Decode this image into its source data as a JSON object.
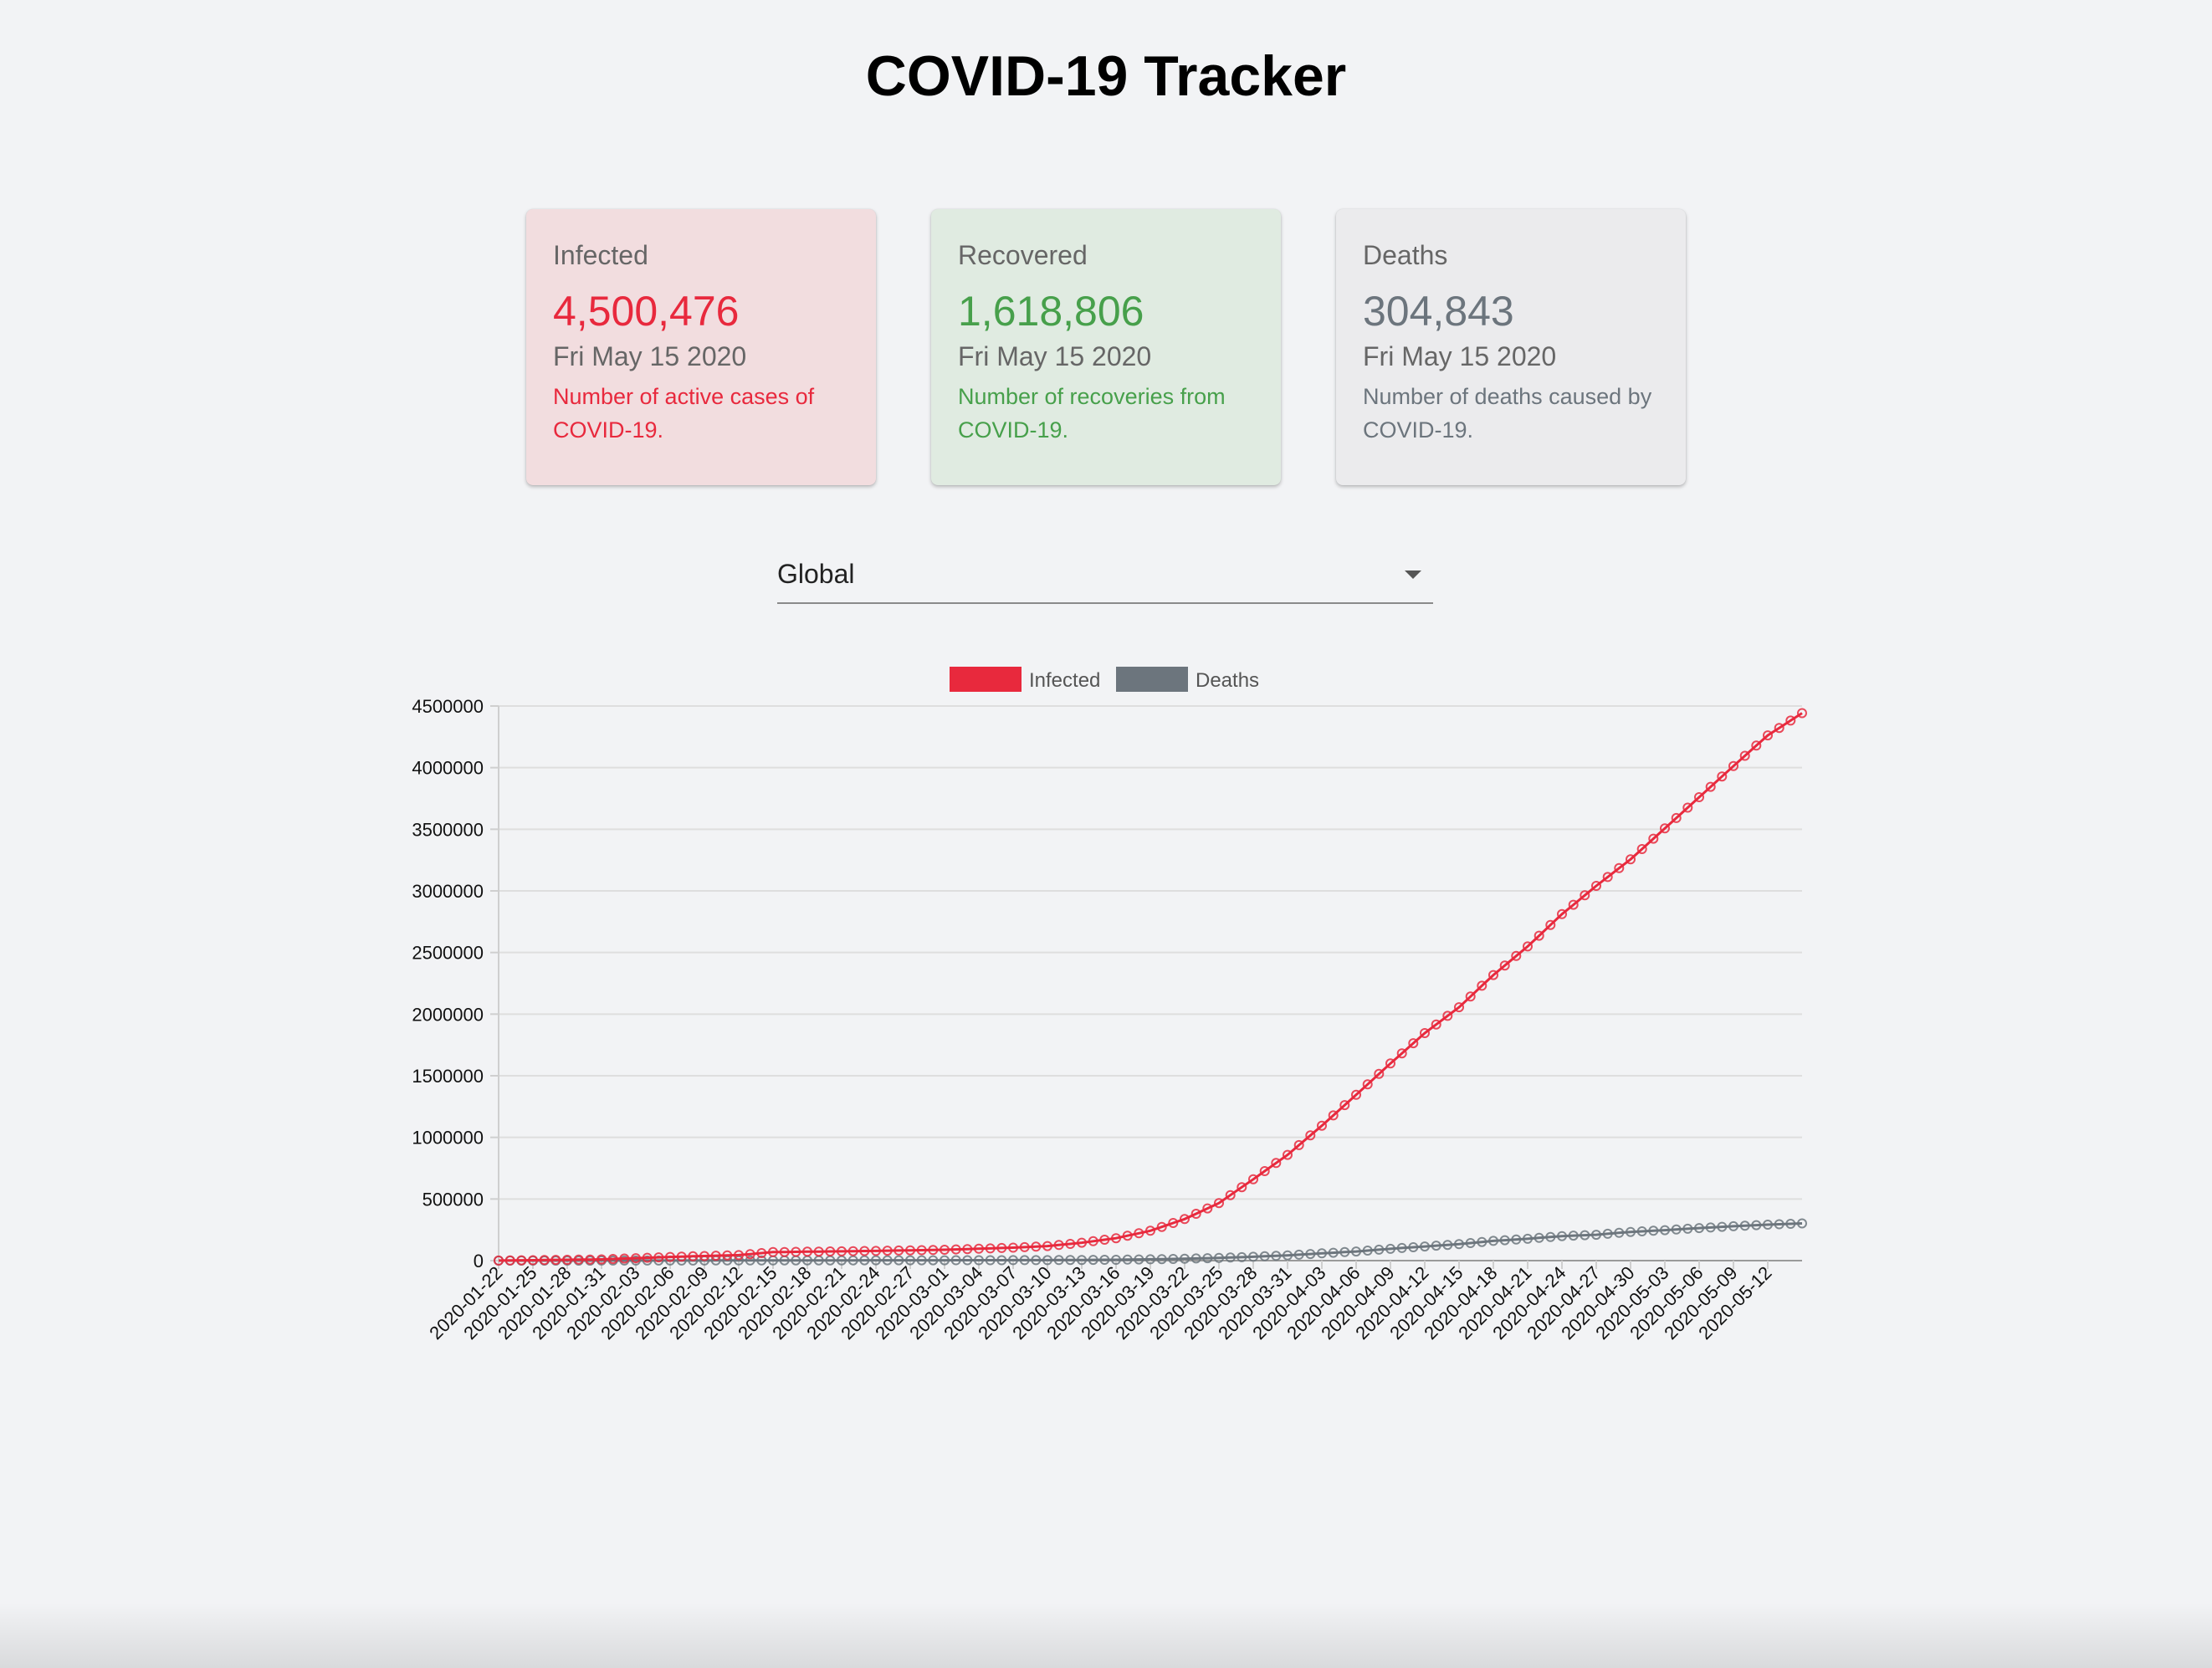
{
  "header": {
    "title": "COVID-19 Tracker"
  },
  "cards": {
    "infected": {
      "label": "Infected",
      "value": "4,500,476",
      "date": "Fri May 15 2020",
      "description": "Number of active cases of COVID-19.",
      "color": "#e8293d"
    },
    "recovered": {
      "label": "Recovered",
      "value": "1,618,806",
      "date": "Fri May 15 2020",
      "description": "Number of recoveries from COVID-19.",
      "color": "#47a04b"
    },
    "deaths": {
      "label": "Deaths",
      "value": "304,843",
      "date": "Fri May 15 2020",
      "description": "Number of deaths caused by COVID-19.",
      "color": "#6c757d"
    }
  },
  "country_select": {
    "selected": "Global",
    "icon": "arrow-drop-down-icon"
  },
  "chart_data": {
    "type": "line",
    "legend_position": "top",
    "grid": true,
    "ylim": [
      0,
      4500000
    ],
    "y_ticks": [
      0,
      500000,
      1000000,
      1500000,
      2000000,
      2500000,
      3000000,
      3500000,
      4000000,
      4500000
    ],
    "x_start": "2020-01-22",
    "x_end": "2020-05-15",
    "x_tick_labels": [
      "2020-01-22",
      "2020-01-25",
      "2020-01-28",
      "2020-01-31",
      "2020-02-03",
      "2020-02-06",
      "2020-02-09",
      "2020-02-12",
      "2020-02-15",
      "2020-02-18",
      "2020-02-21",
      "2020-02-24",
      "2020-02-27",
      "2020-03-01",
      "2020-03-04",
      "2020-03-07",
      "2020-03-10",
      "2020-03-13",
      "2020-03-16",
      "2020-03-19",
      "2020-03-22",
      "2020-03-25",
      "2020-03-28",
      "2020-03-31",
      "2020-04-03",
      "2020-04-06",
      "2020-04-09",
      "2020-04-12",
      "2020-04-15",
      "2020-04-18",
      "2020-04-21",
      "2020-04-24",
      "2020-04-27",
      "2020-04-30",
      "2020-05-03",
      "2020-05-06",
      "2020-05-09",
      "2020-05-12"
    ],
    "series": [
      {
        "name": "Infected",
        "color": "#e8293d",
        "points": [
          [
            "2020-01-22",
            555
          ],
          [
            "2020-01-31",
            10000
          ],
          [
            "2020-02-06",
            30000
          ],
          [
            "2020-02-12",
            45000
          ],
          [
            "2020-02-15",
            69000
          ],
          [
            "2020-02-24",
            79000
          ],
          [
            "2020-03-01",
            88000
          ],
          [
            "2020-03-07",
            105000
          ],
          [
            "2020-03-10",
            118000
          ],
          [
            "2020-03-13",
            145000
          ],
          [
            "2020-03-16",
            182000
          ],
          [
            "2020-03-19",
            242000
          ],
          [
            "2020-03-22",
            337000
          ],
          [
            "2020-03-25",
            467000
          ],
          [
            "2020-03-28",
            660000
          ],
          [
            "2020-03-31",
            858000
          ],
          [
            "2020-04-03",
            1095000
          ],
          [
            "2020-04-06",
            1345000
          ],
          [
            "2020-04-09",
            1600000
          ],
          [
            "2020-04-12",
            1846000
          ],
          [
            "2020-04-15",
            2056000
          ],
          [
            "2020-04-18",
            2317000
          ],
          [
            "2020-04-21",
            2549000
          ],
          [
            "2020-04-24",
            2811000
          ],
          [
            "2020-04-27",
            3041000
          ],
          [
            "2020-04-30",
            3256000
          ],
          [
            "2020-05-03",
            3507000
          ],
          [
            "2020-05-06",
            3760000
          ],
          [
            "2020-05-09",
            4013000
          ],
          [
            "2020-05-12",
            4262000
          ],
          [
            "2020-05-15",
            4442000
          ]
        ]
      },
      {
        "name": "Deaths",
        "color": "#6c757d",
        "points": [
          [
            "2020-01-22",
            17
          ],
          [
            "2020-02-06",
            565
          ],
          [
            "2020-02-15",
            1666
          ],
          [
            "2020-03-01",
            3000
          ],
          [
            "2020-03-10",
            4300
          ],
          [
            "2020-03-16",
            7000
          ],
          [
            "2020-03-22",
            15000
          ],
          [
            "2020-03-25",
            22000
          ],
          [
            "2020-03-28",
            31000
          ],
          [
            "2020-03-31",
            43000
          ],
          [
            "2020-04-03",
            59000
          ],
          [
            "2020-04-06",
            74000
          ],
          [
            "2020-04-09",
            96000
          ],
          [
            "2020-04-12",
            115000
          ],
          [
            "2020-04-15",
            134000
          ],
          [
            "2020-04-18",
            160000
          ],
          [
            "2020-04-21",
            177000
          ],
          [
            "2020-04-24",
            199000
          ],
          [
            "2020-04-27",
            210000
          ],
          [
            "2020-04-30",
            233000
          ],
          [
            "2020-05-03",
            247000
          ],
          [
            "2020-05-06",
            264000
          ],
          [
            "2020-05-09",
            279000
          ],
          [
            "2020-05-12",
            292000
          ],
          [
            "2020-05-15",
            302000
          ]
        ]
      }
    ]
  }
}
